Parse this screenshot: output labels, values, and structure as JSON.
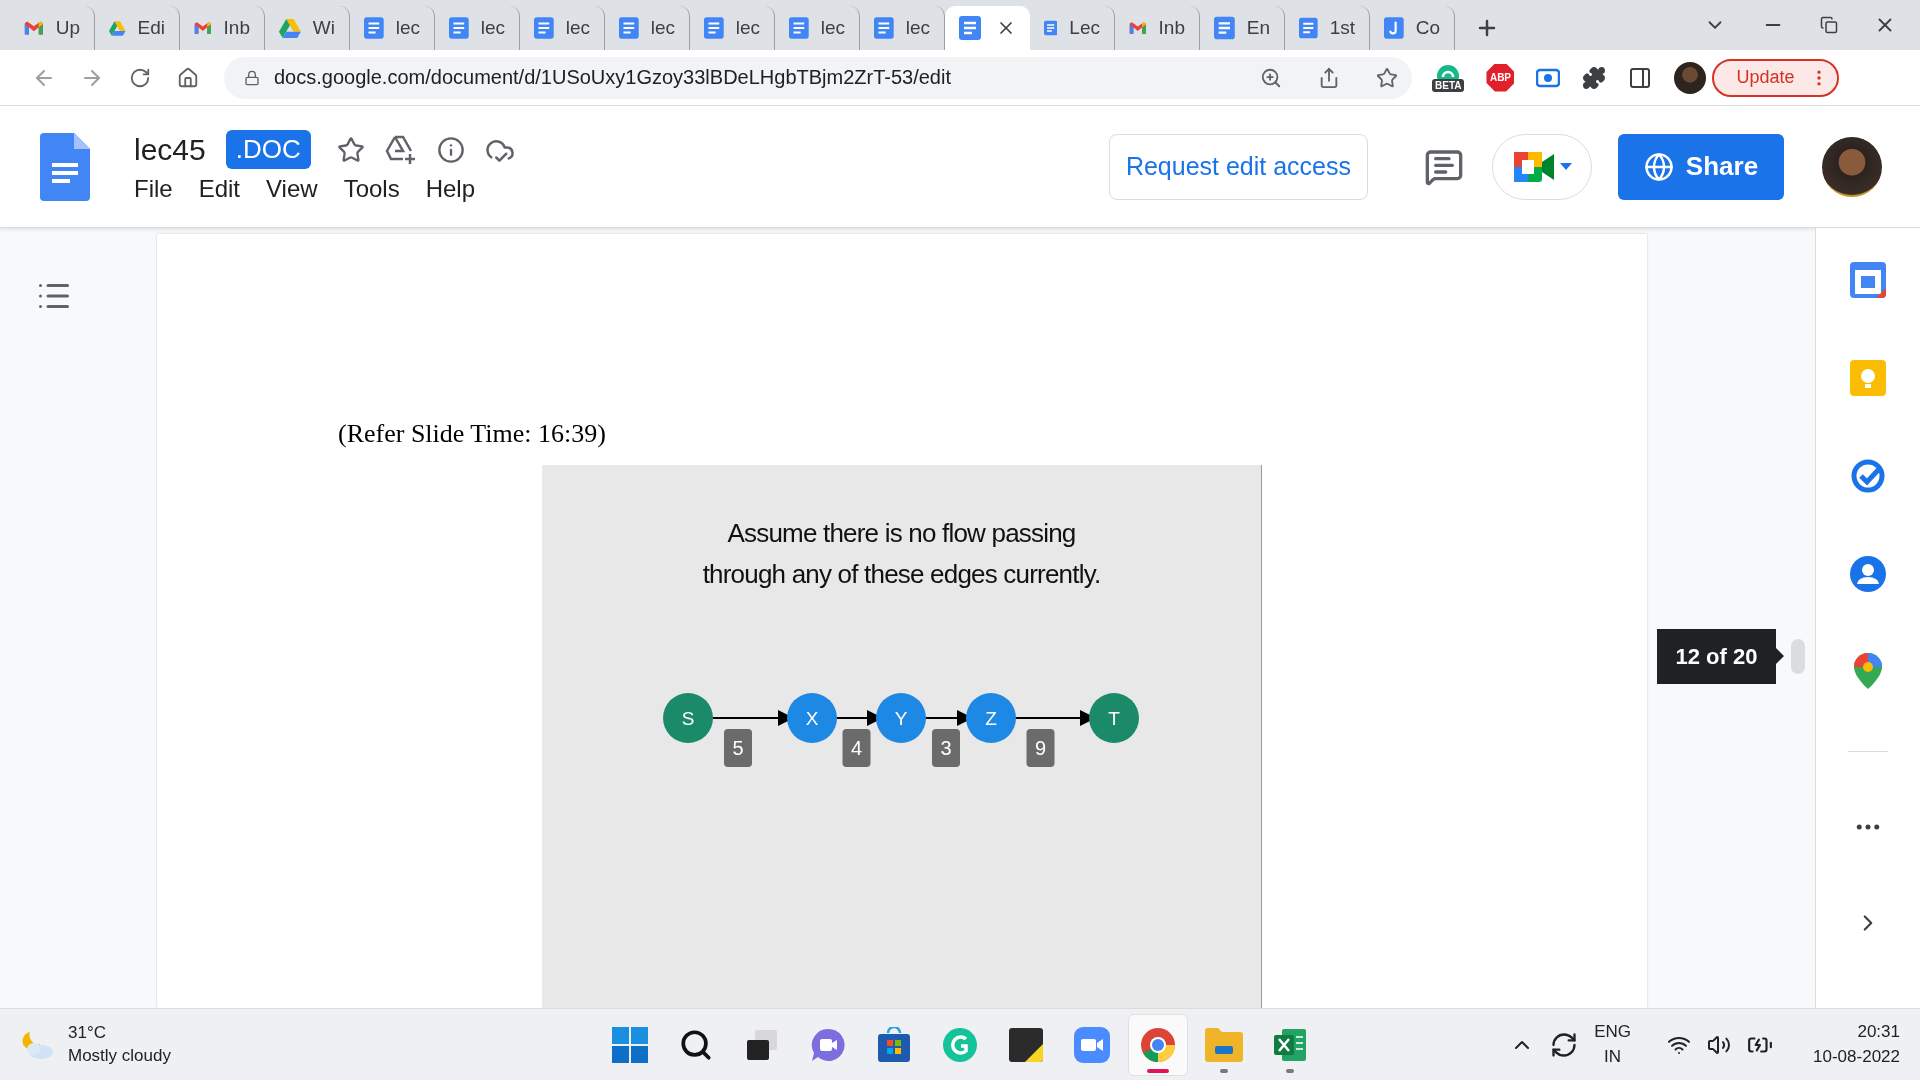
{
  "browser": {
    "tabs": [
      {
        "label": "Up",
        "kind": "gmail",
        "selected": false
      },
      {
        "label": "Edi",
        "kind": "drive",
        "selected": false
      },
      {
        "label": "Inb",
        "kind": "gmail",
        "selected": false
      },
      {
        "label": "Wi",
        "kind": "drive",
        "selected": false
      },
      {
        "label": "lec",
        "kind": "docs",
        "selected": false
      },
      {
        "label": "lec",
        "kind": "docs",
        "selected": false
      },
      {
        "label": "lec",
        "kind": "docs",
        "selected": false
      },
      {
        "label": "lec",
        "kind": "docs",
        "selected": false
      },
      {
        "label": "lec",
        "kind": "docs",
        "selected": false
      },
      {
        "label": "lec",
        "kind": "docs",
        "selected": false
      },
      {
        "label": "lec",
        "kind": "docs",
        "selected": false
      },
      {
        "kind": "docs",
        "selected": true
      },
      {
        "label": "Lec",
        "kind": "docs",
        "selected": false
      },
      {
        "label": "Inb",
        "kind": "gmail",
        "selected": false
      },
      {
        "label": "En",
        "kind": "docs",
        "selected": false
      },
      {
        "label": "1st",
        "kind": "docs",
        "selected": false
      },
      {
        "label": "Co",
        "kind": "journal",
        "selected": false
      }
    ],
    "address": "docs.google.com/document/d/1USoUxy1Gzoy33lBDeLHgbTBjm2ZrT-53/edit",
    "extension_badge": "BETA",
    "adblock_label": "ABP",
    "update_button": "Update"
  },
  "docs": {
    "title": "lec45",
    "format_badge": ".DOC",
    "menu": [
      "File",
      "Edit",
      "View",
      "Tools",
      "Help"
    ],
    "request_button": "Request edit access",
    "share_button": "Share"
  },
  "document": {
    "caption": "(Refer Slide Time: 16:39)",
    "slide": {
      "title_lines": [
        "Assume there is no flow passing",
        "through any of these edges currently."
      ],
      "nodes": [
        {
          "label": "S",
          "color": "#1b8a69"
        },
        {
          "label": "X",
          "color": "#1e88e5"
        },
        {
          "label": "Y",
          "color": "#1e88e5"
        },
        {
          "label": "Z",
          "color": "#1e88e5"
        },
        {
          "label": "T",
          "color": "#1b8a69"
        }
      ],
      "edges": [
        {
          "weight": "5"
        },
        {
          "weight": "4"
        },
        {
          "weight": "3"
        },
        {
          "weight": "9"
        }
      ]
    }
  },
  "page_indicator": "12 of 20",
  "taskbar": {
    "temperature": "31°C",
    "condition": "Mostly cloudy",
    "apps": [
      {
        "kind": "start",
        "selected": false,
        "running": false
      },
      {
        "kind": "search",
        "selected": false,
        "running": false
      },
      {
        "kind": "taskview",
        "selected": false,
        "running": false
      },
      {
        "kind": "chat",
        "selected": false,
        "running": false
      },
      {
        "kind": "store",
        "selected": false,
        "running": false
      },
      {
        "kind": "grammarly",
        "selected": false,
        "running": false
      },
      {
        "kind": "sticky",
        "selected": false,
        "running": false
      },
      {
        "kind": "zoom",
        "selected": false,
        "running": false
      },
      {
        "kind": "chrome",
        "selected": true,
        "running": true
      },
      {
        "kind": "explorer",
        "selected": false,
        "running": true
      },
      {
        "kind": "excel",
        "selected": false,
        "running": true
      }
    ],
    "language": "ENG",
    "region": "IN",
    "time": "20:31",
    "date": "10-08-2022"
  }
}
